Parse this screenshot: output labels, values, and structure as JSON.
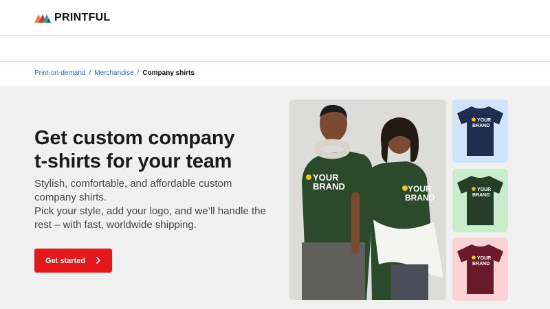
{
  "brand": {
    "name": "PRINTFUL",
    "logo_colors": [
      "#f07c45",
      "#d9303d",
      "#2d9fa0",
      "#1e4f6b"
    ]
  },
  "breadcrumb": {
    "items": [
      "Print-on-demand",
      "Merchandise"
    ],
    "separator": "/",
    "current": "Company shirts"
  },
  "hero": {
    "title_line1": "Get custom company",
    "title_line2": "t-shirts for your team",
    "desc_line1": "Stylish, comfortable, and affordable custom company shirts.",
    "desc_line2": "Pick your style, add your logo, and we’ll handle the rest – with fast, worldwide shipping.",
    "cta_label": "Get started",
    "shirt_print_line1": "YOUR",
    "shirt_print_line2": "BRAND"
  },
  "thumbnails": [
    {
      "shirt_color": "#1f2e4f",
      "bg": "#cfe3fb",
      "print_line1": "YOUR",
      "print_line2": "BRAND"
    },
    {
      "shirt_color": "#243f26",
      "bg": "#c9eccb",
      "print_line1": "YOUR",
      "print_line2": "BRAND"
    },
    {
      "shirt_color": "#6a1a2b",
      "bg": "#fbd3d6",
      "print_line1": "YOUR",
      "print_line2": "BRAND"
    }
  ],
  "colors": {
    "accent": "#e4171b",
    "link": "#2a6fb0",
    "hero_bg": "#f0f0f0"
  }
}
